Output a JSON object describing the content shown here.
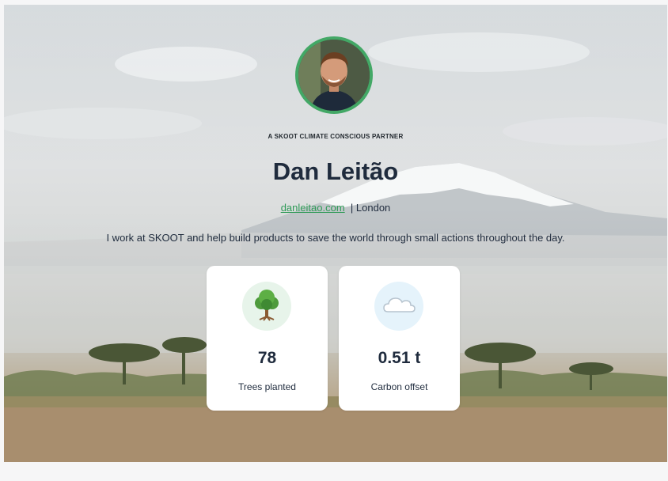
{
  "profile": {
    "eyebrow": "A SKOOT CLIMATE CONSCIOUS PARTNER",
    "name": "Dan Leitão",
    "website": "danleitao.com",
    "separator": "|",
    "location": "London",
    "bio": "I work at SKOOT and help build products to save the world through small actions throughout the day."
  },
  "stats": [
    {
      "value": "78",
      "label": "Trees planted",
      "icon": "tree-icon"
    },
    {
      "value": "0.51 t",
      "label": "Carbon offset",
      "icon": "cloud-icon"
    }
  ],
  "colors": {
    "accent": "#43a866",
    "link": "#2f9a57",
    "text": "#1f2b3d",
    "tree_icon_bg": "#e7f4ea",
    "cloud_icon_bg": "#e5f3fb"
  }
}
